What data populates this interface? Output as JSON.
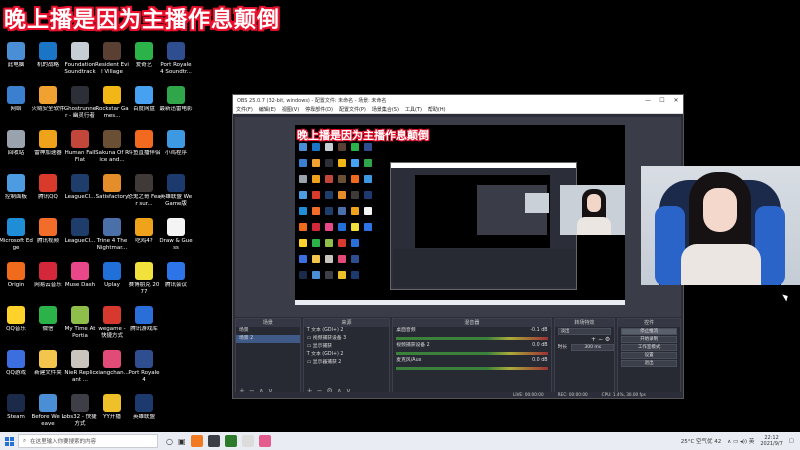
{
  "banner": "晚上播是因为主播作息颠倒",
  "desktop_icons": [
    {
      "label": "此电脑",
      "color": "#4a8fd6",
      "col": 0,
      "row": 0
    },
    {
      "label": "网络",
      "color": "#3a7fd0",
      "col": 0,
      "row": 1
    },
    {
      "label": "回收站",
      "color": "#9aa2ad",
      "col": 0,
      "row": 2
    },
    {
      "label": "控制面板",
      "color": "#4d9be0",
      "col": 0,
      "row": 3
    },
    {
      "label": "Microsoft Edge",
      "color": "#1f8ed6",
      "col": 0,
      "row": 4
    },
    {
      "label": "Origin",
      "color": "#f06b1b",
      "col": 0,
      "row": 5
    },
    {
      "label": "QQ音乐",
      "color": "#ffd12b",
      "col": 0,
      "row": 6
    },
    {
      "label": "QQ游戏",
      "color": "#3c6ee0",
      "col": 0,
      "row": 7
    },
    {
      "label": "Steam",
      "color": "#1b2a48",
      "col": 0,
      "row": 8
    },
    {
      "label": "机的战略",
      "color": "#1a75c7",
      "col": 1,
      "row": 0
    },
    {
      "label": "火绒安全软件",
      "color": "#f1a12f",
      "col": 1,
      "row": 1
    },
    {
      "label": "雷神加速器",
      "color": "#f0a31a",
      "col": 1,
      "row": 2
    },
    {
      "label": "腾讯QQ",
      "color": "#d83a2c",
      "col": 1,
      "row": 3
    },
    {
      "label": "腾讯视频",
      "color": "#f36d2a",
      "col": 1,
      "row": 4
    },
    {
      "label": "网易云音乐",
      "color": "#d3283a",
      "col": 1,
      "row": 5
    },
    {
      "label": "微信",
      "color": "#2bb34a",
      "col": 1,
      "row": 6
    },
    {
      "label": "新建文件夹",
      "color": "#f4c54d",
      "col": 1,
      "row": 7
    },
    {
      "label": "Before We Leave",
      "color": "#4a8fd6",
      "col": 1,
      "row": 8
    },
    {
      "label": "Foundation Soundtrack",
      "color": "#c7cdd5",
      "col": 2,
      "row": 0
    },
    {
      "label": "Ghostrunner - 幽灵行者",
      "color": "#2d2f38",
      "col": 2,
      "row": 1
    },
    {
      "label": "Human Fall Flat",
      "color": "#c2473a",
      "col": 2,
      "row": 2
    },
    {
      "label": "LeagueCl...",
      "color": "#1f3d6b",
      "col": 2,
      "row": 3
    },
    {
      "label": "LeagueCl...",
      "color": "#1f3d6b",
      "col": 2,
      "row": 4
    },
    {
      "label": "Muse Dash",
      "color": "#e8478a",
      "col": 2,
      "row": 5
    },
    {
      "label": "My Time At Portia",
      "color": "#8fbe4a",
      "col": 2,
      "row": 6
    },
    {
      "label": "NieR Replicant ...",
      "color": "#c9c4bd",
      "col": 2,
      "row": 7
    },
    {
      "label": "obs32 - 快捷方式",
      "color": "#3e3e46",
      "col": 2,
      "row": 8
    },
    {
      "label": "Resident Evil Village",
      "color": "#5a3f33",
      "col": 3,
      "row": 0
    },
    {
      "label": "Rockstar Games...",
      "color": "#f2b617",
      "col": 3,
      "row": 1
    },
    {
      "label": "Sakuna Of Rice and...",
      "color": "#6b4f35",
      "col": 3,
      "row": 2
    },
    {
      "label": "Satisfactory",
      "color": "#e58d2a",
      "col": 3,
      "row": 3
    },
    {
      "label": "Trine 4 The Nightmar...",
      "color": "#4b6fa8",
      "col": 3,
      "row": 4
    },
    {
      "label": "Uplay",
      "color": "#2170d9",
      "col": 3,
      "row": 5
    },
    {
      "label": "wegame - 快捷方式",
      "color": "#d8392f",
      "col": 3,
      "row": 6
    },
    {
      "label": "xiangchan...",
      "color": "#e24a77",
      "col": 3,
      "row": 7
    },
    {
      "label": "YY开播",
      "color": "#f0c02a",
      "col": 3,
      "row": 8
    },
    {
      "label": "爱奇艺",
      "color": "#2bb34a",
      "col": 4,
      "row": 0
    },
    {
      "label": "百度网盘",
      "color": "#47a1f2",
      "col": 4,
      "row": 1
    },
    {
      "label": "斗鱼直播伴侣",
      "color": "#f26a1f",
      "col": 4,
      "row": 2
    },
    {
      "label": "恐鬼之哥 Fear sur...",
      "color": "#3f3a38",
      "col": 4,
      "row": 3
    },
    {
      "label": "吃鸡4?",
      "color": "#f0a31a",
      "col": 4,
      "row": 4
    },
    {
      "label": "赛博朋克 2077",
      "color": "#f2e13d",
      "col": 4,
      "row": 5
    },
    {
      "label": "腾讯游戏库",
      "color": "#2a6fd8",
      "col": 4,
      "row": 6
    },
    {
      "label": "Port Royale 4",
      "color": "#2e4e8f",
      "col": 4,
      "row": 7
    },
    {
      "label": "英雄联盟",
      "color": "#1c3a6e",
      "col": 4,
      "row": 8
    },
    {
      "label": "Port Royale 4 Soundtr...",
      "color": "#2e4e8f",
      "col": 5,
      "row": 0
    },
    {
      "label": "最新迅雷电影",
      "color": "#2fa64a",
      "col": 5,
      "row": 1
    },
    {
      "label": "小鸡程序",
      "color": "#3d9ae2",
      "col": 5,
      "row": 2
    },
    {
      "label": "英雄联盟 WeGame版",
      "color": "#1c3a6e",
      "col": 5,
      "row": 3
    },
    {
      "label": "Draw & Guess",
      "color": "#f4f4f4",
      "col": 5,
      "row": 4
    },
    {
      "label": "腾讯会议",
      "color": "#2d74e8",
      "col": 5,
      "row": 5
    }
  ],
  "obs": {
    "title": "OBS 25.0.7 (32-bit, windows) - 配置文件: 未命名 - 场景: 未命名",
    "menu": [
      "文件(F)",
      "编辑(E)",
      "视图(V)",
      "停靠部件(D)",
      "配置文件(P)",
      "场景集合(S)",
      "工具(T)",
      "帮助(H)"
    ],
    "window_controls": [
      "—",
      "☐",
      "✕"
    ],
    "scenes_header": "场景",
    "scenes": [
      "场景",
      "场景 2"
    ],
    "sources_header": "来源",
    "sources": [
      "文本 (GDI+) 2",
      "视频捕获设备 3",
      "显示捕获",
      "文本 (GDI+) 2",
      "显示器捕获 2"
    ],
    "mixer_header": "混音器",
    "mixer": [
      {
        "name": "桌面音频",
        "db": "-0.1 dB"
      },
      {
        "name": "视频捕获设备 2",
        "db": "0.0 dB"
      },
      {
        "name": "麦克风/Aux",
        "db": "0.0 dB"
      }
    ],
    "transitions_header": "转场特效",
    "transition_select": "淡出",
    "duration_label": "时长",
    "duration_value": "300 ms",
    "controls_header": "控件",
    "controls": [
      "停止推流",
      "开始录制",
      "工作室模式",
      "设置",
      "退出"
    ],
    "status": [
      "LIVE: 00:00:00",
      "REC: 00:00:00",
      "CPU: 1.4%, 30.00 fps"
    ]
  },
  "taskbar": {
    "search_placeholder": "在这里输入你要搜索的内容",
    "weather": "25°C 空气优 42",
    "time": "22:12",
    "date": "2021/9/7",
    "apps": [
      "#f07b22",
      "#3b3e47",
      "#2d7a2d",
      "#dcdcdc",
      "#e45c8e"
    ]
  }
}
